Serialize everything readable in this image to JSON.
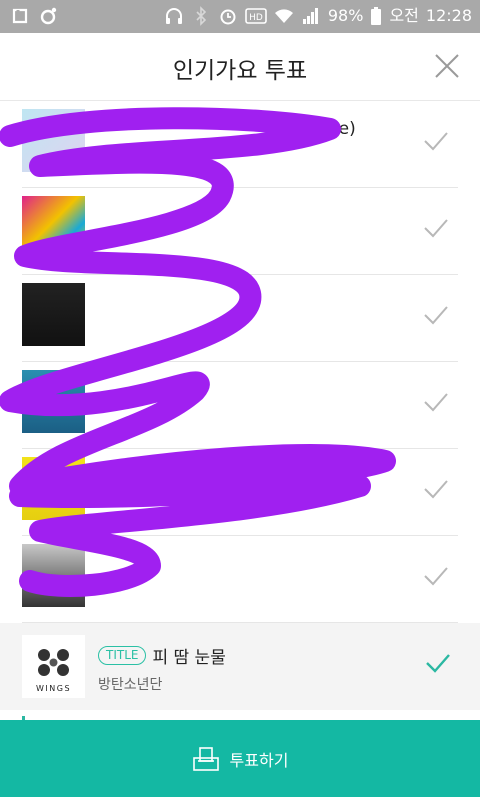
{
  "status": {
    "battery": "98%",
    "ampm": "오전",
    "time": "12:28"
  },
  "header": {
    "title": "인기가요 투표"
  },
  "list": {
    "hidden_items": [
      {
        "text_fragment": "te)"
      },
      {
        "text_fragment": ""
      },
      {
        "text_fragment": ")"
      },
      {
        "text_fragment": ""
      },
      {
        "text_fragment": ")"
      },
      {
        "text_fragment": ""
      }
    ],
    "selected": {
      "badge": "TITLE",
      "song": "피 땀 눈물",
      "artist": "방탄소년단",
      "album_text": "WINGS"
    }
  },
  "footer": {
    "vote_label": "투표하기"
  },
  "colors": {
    "accent": "#14b8a3",
    "scribble": "#a020f0"
  }
}
